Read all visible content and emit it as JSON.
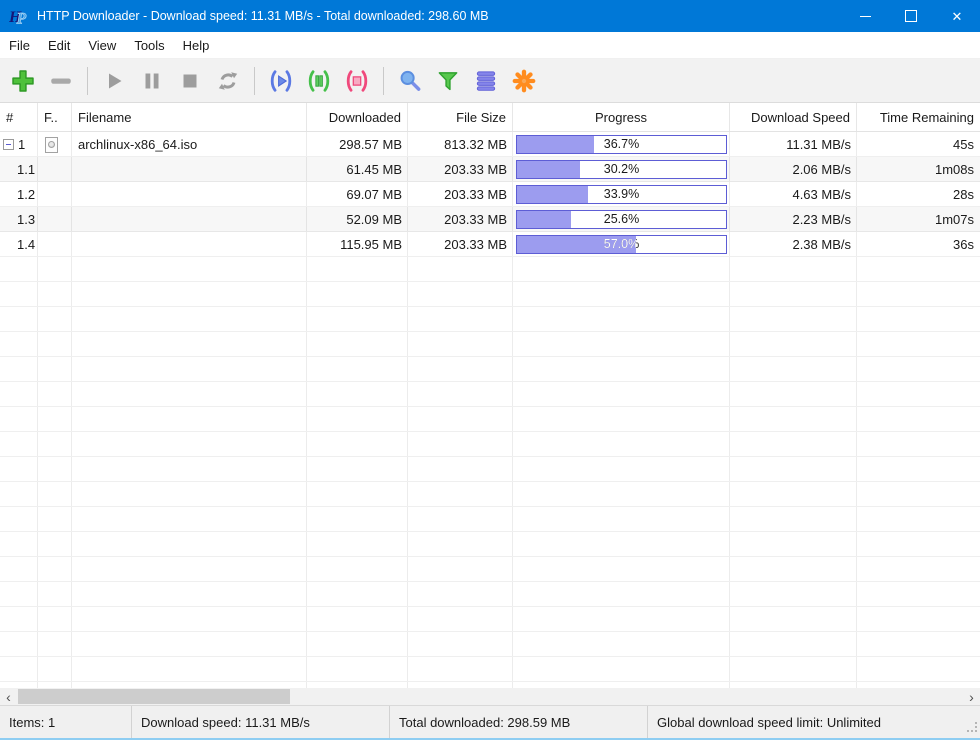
{
  "titlebar": {
    "title": "HTTP Downloader - Download speed: 11.31 MB/s - Total downloaded: 298.60 MB",
    "app_name": "HTTP Downloader"
  },
  "menu": {
    "items": [
      "File",
      "Edit",
      "View",
      "Tools",
      "Help"
    ]
  },
  "toolbar": {
    "buttons": [
      {
        "id": "add-download",
        "icon": "plus-icon",
        "color": "#4fc13b"
      },
      {
        "id": "remove-download",
        "icon": "minus-icon",
        "color": "#a9a9a9"
      },
      {
        "id": "start-download",
        "icon": "play-icon",
        "color": "#9d9d9d"
      },
      {
        "id": "pause-download",
        "icon": "pause-icon",
        "color": "#9d9d9d"
      },
      {
        "id": "stop-download",
        "icon": "stop-icon",
        "color": "#9d9d9d"
      },
      {
        "id": "restart-download",
        "icon": "restart-icon",
        "color": "#9d9d9d"
      },
      {
        "id": "start-queue",
        "icon": "bracket-play-icon",
        "color": "#5b79e3"
      },
      {
        "id": "pause-queue",
        "icon": "bracket-pause-icon",
        "color": "#45c04a"
      },
      {
        "id": "stop-queue",
        "icon": "bracket-stop-icon",
        "color": "#f0497c"
      },
      {
        "id": "search",
        "icon": "search-icon",
        "color": "#5c8fe0"
      },
      {
        "id": "filter",
        "icon": "filter-icon",
        "color": "#58c84e"
      },
      {
        "id": "site-manager",
        "icon": "queue-list-icon",
        "color": "#7a7ae8"
      },
      {
        "id": "settings",
        "icon": "settings-icon",
        "color": "#ff8c1f"
      }
    ]
  },
  "table": {
    "columns": [
      {
        "label": "#"
      },
      {
        "label": "F.."
      },
      {
        "label": "Filename"
      },
      {
        "label": "Downloaded"
      },
      {
        "label": "File Size"
      },
      {
        "label": "Progress"
      },
      {
        "label": "Download Speed"
      },
      {
        "label": "Time Remaining"
      }
    ],
    "rows": [
      {
        "num": "1",
        "filename": "archlinux-x86_64.iso",
        "downloaded": "298.57 MB",
        "size": "813.32 MB",
        "progress": 36.7,
        "progress_label": "36.7%",
        "speed": "11.31 MB/s",
        "remaining": "45s"
      },
      {
        "num": "1.1",
        "filename": "",
        "downloaded": "61.45 MB",
        "size": "203.33 MB",
        "progress": 30.2,
        "progress_label": "30.2%",
        "speed": "2.06 MB/s",
        "remaining": "1m08s"
      },
      {
        "num": "1.2",
        "filename": "",
        "downloaded": "69.07 MB",
        "size": "203.33 MB",
        "progress": 33.9,
        "progress_label": "33.9%",
        "speed": "4.63 MB/s",
        "remaining": "28s"
      },
      {
        "num": "1.3",
        "filename": "",
        "downloaded": "52.09 MB",
        "size": "203.33 MB",
        "progress": 25.6,
        "progress_label": "25.6%",
        "speed": "2.23 MB/s",
        "remaining": "1m07s"
      },
      {
        "num": "1.4",
        "filename": "",
        "downloaded": "115.95 MB",
        "size": "203.33 MB",
        "progress": 57.0,
        "progress_label": "57.0%",
        "speed": "2.38 MB/s",
        "remaining": "36s"
      }
    ]
  },
  "statusbar": {
    "items": [
      "Items: 1",
      "Download speed: 11.31 MB/s",
      "Total downloaded: 298.59 MB",
      "Global download speed limit: Unlimited"
    ]
  },
  "colors": {
    "titlebar": "#0078d7",
    "progress_fill": "#9c9cef",
    "progress_border": "#5d5dd5"
  }
}
